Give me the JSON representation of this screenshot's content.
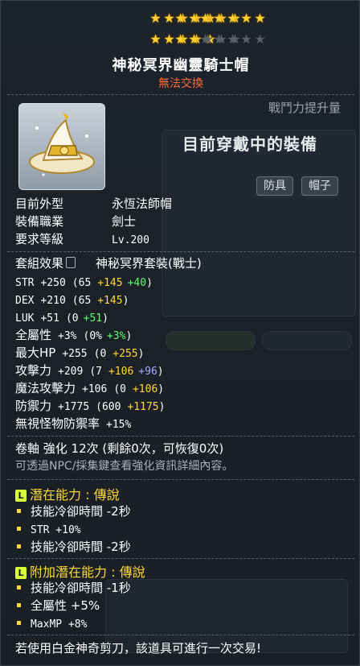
{
  "stars": {
    "row1": [
      [
        1,
        1,
        1,
        1,
        1
      ],
      [
        1,
        1,
        1,
        1,
        1
      ],
      [
        1,
        1,
        1,
        1,
        1
      ]
    ],
    "row2": [
      [
        1,
        1,
        1,
        1,
        1
      ],
      [
        1,
        1,
        0,
        0,
        0
      ],
      [
        0,
        0,
        0,
        0,
        0
      ]
    ]
  },
  "item": {
    "name": "神秘冥界幽靈騎士帽",
    "trade_status": "無法交換"
  },
  "compare": {
    "cp_label": "戰鬥力提升量",
    "wearing_label": "目前穿戴中的裝備",
    "tags": [
      "防具",
      "帽子"
    ]
  },
  "info": [
    {
      "label": "目前外型",
      "value": "永恆法師帽"
    },
    {
      "label": "裝備職業",
      "value": "劍士"
    },
    {
      "label": "要求等級",
      "value": "Lv.200"
    }
  ],
  "set": {
    "label": "套組效果",
    "value": "神秘冥界套裝(戰士)"
  },
  "stats": [
    {
      "name": "STR",
      "total": "+250",
      "base": "(65",
      "add1": "+145",
      "add2": "+40",
      "add2_color": "g",
      "close": ")"
    },
    {
      "name": "DEX",
      "total": "+210",
      "base": "(65",
      "add1": "+145",
      "add2": "",
      "add2_color": "g",
      "close": ")"
    },
    {
      "name": "LUK",
      "total": "+51",
      "base": "(0",
      "add1": "",
      "add2": "+51",
      "add2_color": "g",
      "close": ")"
    },
    {
      "name": "全屬性",
      "total": "+3%",
      "base": "(0%",
      "add1": "",
      "add2": "+3%",
      "add2_color": "g",
      "close": ")"
    },
    {
      "name": "最大HP",
      "total": "+255",
      "base": "(0",
      "add1": "+255",
      "add2": "",
      "add2_color": "g",
      "close": ")"
    },
    {
      "name": "攻擊力",
      "total": "+209",
      "base": "(7",
      "add1": "+106",
      "add2": "+96",
      "add2_color": "b",
      "close": ")"
    },
    {
      "name": "魔法攻擊力",
      "total": "+106",
      "base": "(0",
      "add1": "+106",
      "add2": "",
      "add2_color": "g",
      "close": ")"
    },
    {
      "name": "防禦力",
      "total": "+1775",
      "base": "(600",
      "add1": "+1175",
      "add2": "",
      "add2_color": "g",
      "close": ")"
    },
    {
      "name": "無視怪物防禦率",
      "total": "+15%",
      "base": "",
      "add1": "",
      "add2": "",
      "add2_color": "g",
      "close": ""
    }
  ],
  "scroll": {
    "line": "卷軸 強化 12次 (剩餘0次，可恢復0次)",
    "hint": "可透過NPC/採集鍵查看強化資訊詳細內容。"
  },
  "potential": {
    "title": "潛在能力 : 傳說",
    "badge": "L",
    "lines": [
      "技能冷卻時間 -2秒",
      "STR +10%",
      "技能冷卻時間 -2秒"
    ]
  },
  "bonus_potential": {
    "title": "附加潛在能力 : 傳說",
    "badge": "L",
    "lines": [
      "技能冷卻時間 -1秒",
      "全屬性 +5%",
      "MaxMP +8%"
    ]
  },
  "footer": "若使用白金神奇剪刀，該道具可進行一次交易!",
  "colors": {
    "star": "#ffd230",
    "legend_title": "#ffd83a",
    "untradeable": "#ff6a3a",
    "green": "#58ff6a",
    "blue": "#a7a7ff"
  }
}
